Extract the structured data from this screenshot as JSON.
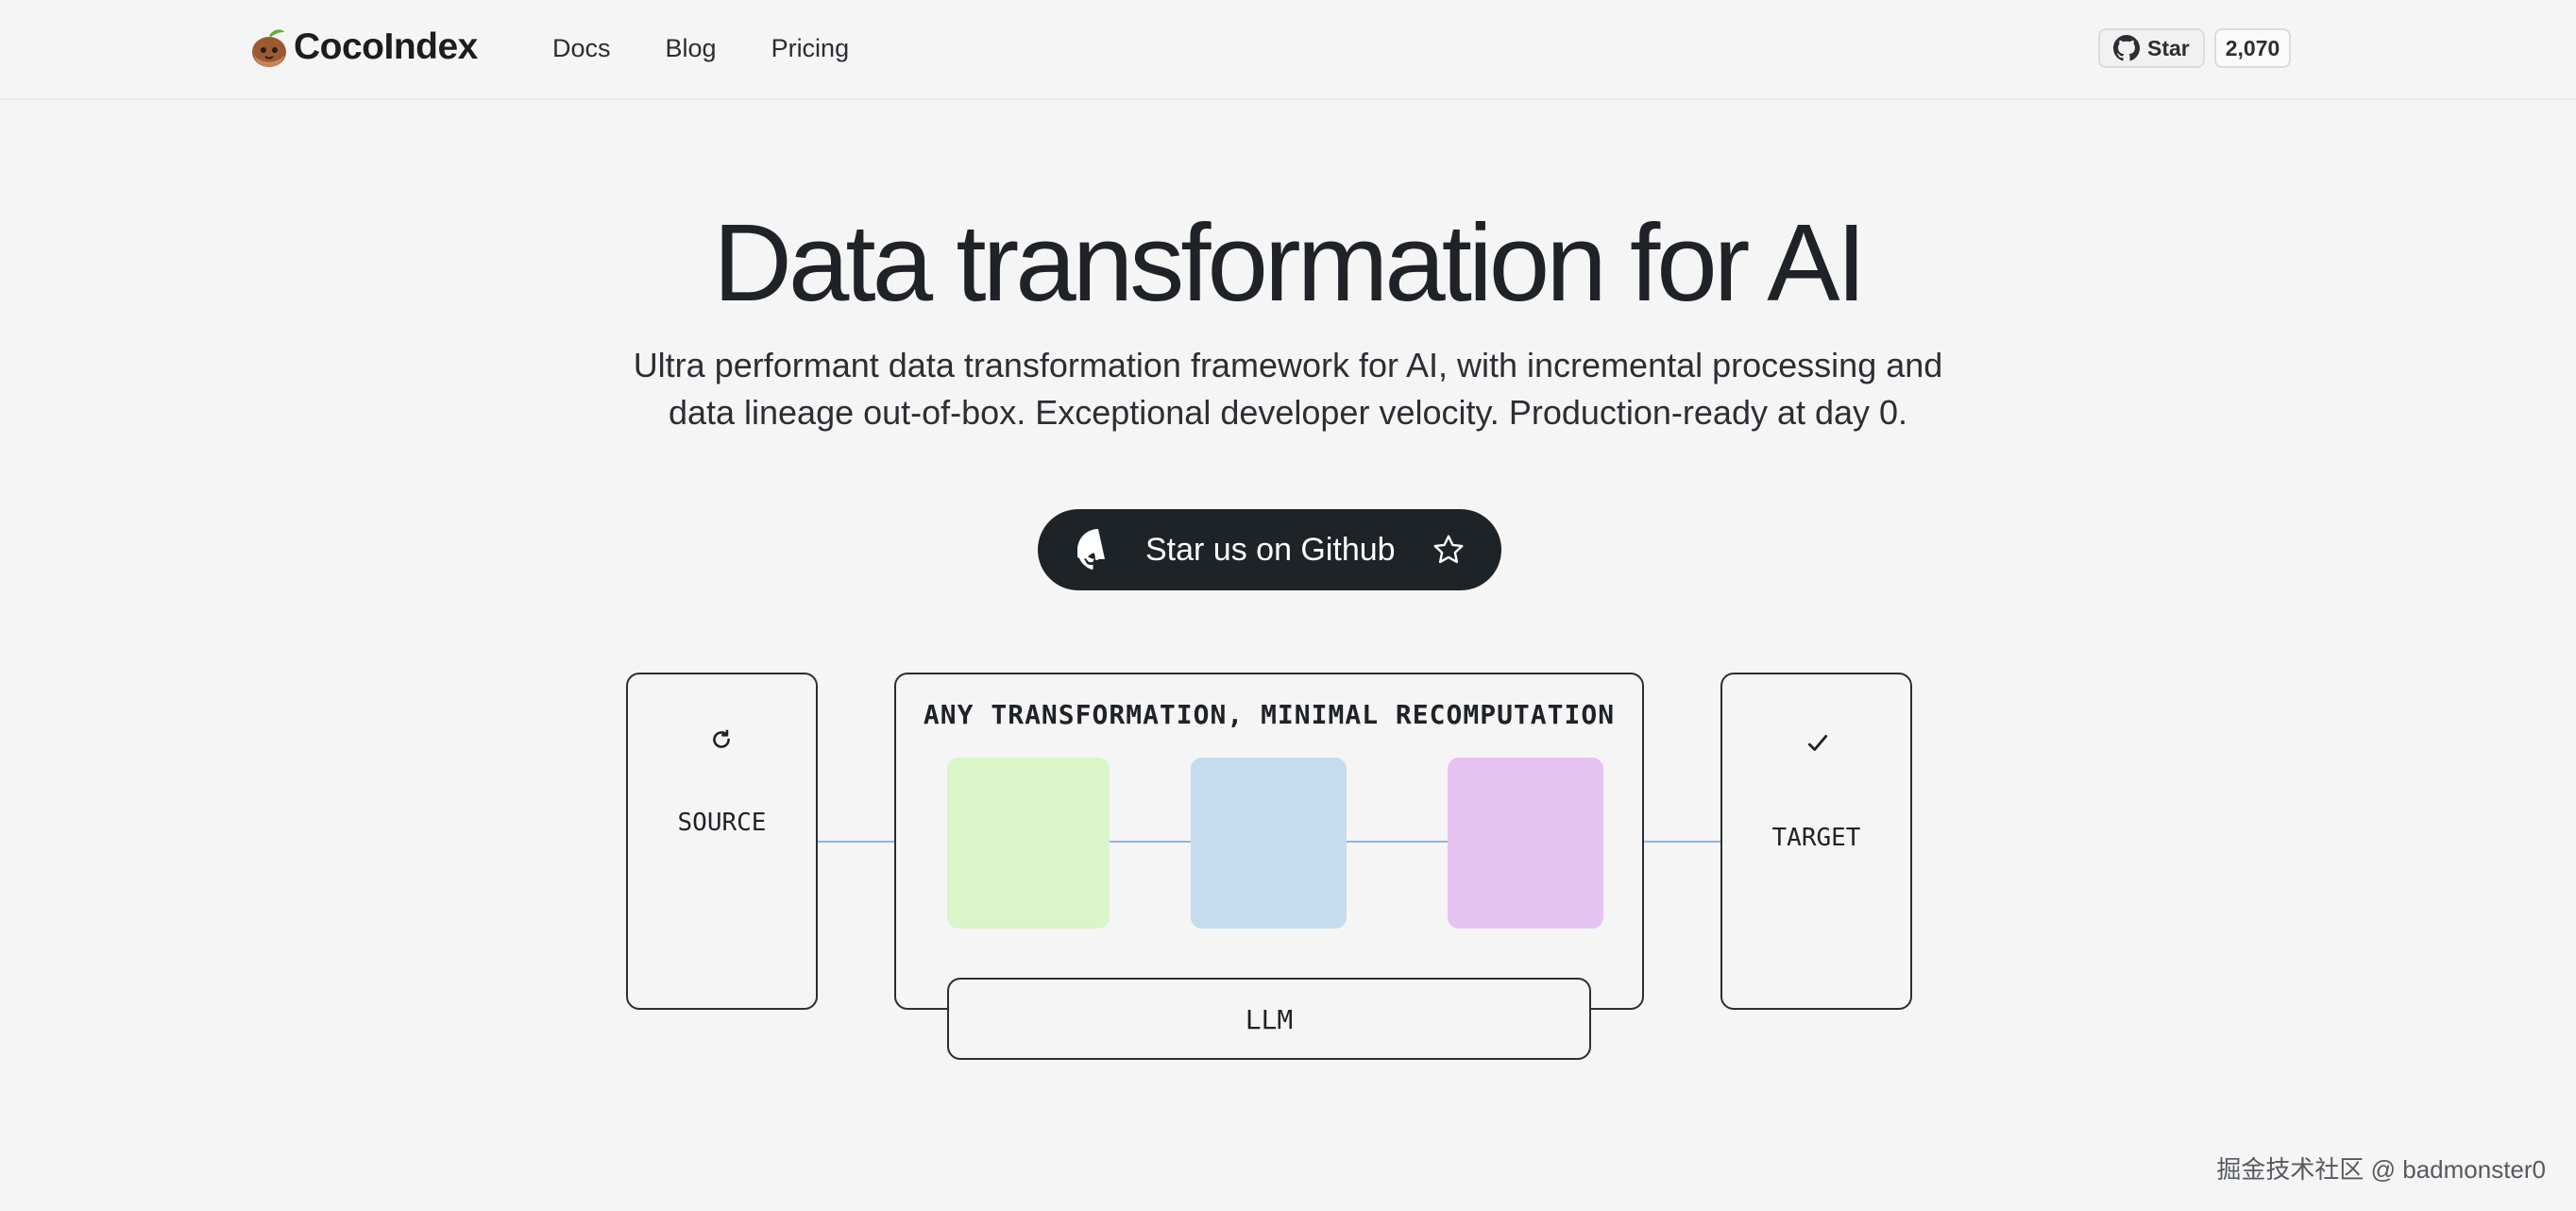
{
  "header": {
    "brand": "CocoIndex",
    "nav": [
      "Docs",
      "Blog",
      "Pricing"
    ],
    "github": {
      "star_label": "Star",
      "star_count": "2,070"
    }
  },
  "hero": {
    "title": "Data transformation for AI",
    "subtitle_line1": "Ultra performant data transformation framework for AI, with incremental processing and",
    "subtitle_line2": "data lineage out-of-box. Exceptional developer velocity. Production-ready at day 0.",
    "cta_label": "Star us on Github"
  },
  "diagram": {
    "source_label": "SOURCE",
    "transform_title": "ANY TRANSFORMATION, MINIMAL RECOMPUTATION",
    "target_label": "TARGET",
    "llm_label": "LLM",
    "tile_colors": [
      "#daf5ca",
      "#c4dcee",
      "#e6c2f0"
    ],
    "icons": {
      "source": "refresh-icon",
      "target": "check-icon"
    }
  },
  "watermark": "掘金技术社区 @ badmonster0",
  "colors": {
    "cta_bg": "#1e2328",
    "connector": "#8fb6dc",
    "page_bg": "#f5f5f5"
  }
}
